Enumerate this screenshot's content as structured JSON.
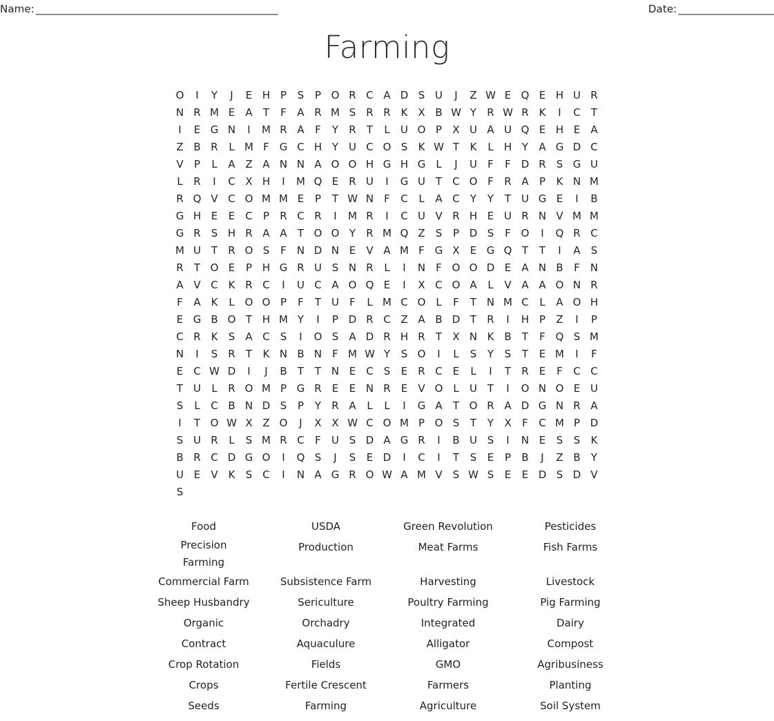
{
  "header": {
    "name_label": "Name:",
    "name_rule": "________________________________________________",
    "date_label": "Date:",
    "date_rule": "___________________"
  },
  "title": "Farming",
  "puzzle": {
    "columns": 25,
    "rows": 24,
    "grid": [
      "O I Y J E H P S P O R C A D S U J Z W E Q E H U",
      "R N R M E A T F A R M S R R K X B W Y R W R K I",
      "C T I E G N I M R A F Y R T L U O P X U A U Q E",
      "H E A Z B R L M F G C H Y U C O S K W T K L H Y",
      "A G D C V P L A Z A N N A O O H G H G L J U F F",
      "D R S G U L R I C X H I M Q E R U I G U T C O F",
      "R A P K N M R Q V C O M M E P T W N F C L A C Y",
      "Y T U G E I B G H E E C P R C R I M R I C U V R",
      "H E U R N V M M G R S H R A A T O O Y R M Q Z S",
      "P D S F O I Q R C M U T R O S F N D N E V A M F",
      "G X E G Q T T I A S R T O E P H G R U S N R L I",
      "N F O O D E A N B F N A V C K R C I U C A O Q E",
      "I X C O A L V A A O N R F A K L O O P F T U F L",
      "M C O L F T N M C L A O H E G B O T H M Y I P D",
      "R C Z A B D T R I H P Z I P C R K S A C S I O S",
      "A D R H R T X N K B T F Q S M N I S R T K N B N",
      "F M W Y S O I L S Y S T E M I F E C W D I J B T",
      "T N E C S E R C E L I T R E F C C T U L R O M P",
      "G R E E N R E V O L U T I O N O E U S L C B N D",
      "S P Y R A L L I G A T O R A D G N R A I T O W X",
      "Z O J X X W C O M P O S T Y X F C M P D S U R L",
      "S M R C F U S D A G R I B U S I N E S S K B R C",
      "D G O I Q S J S E D I C I T S E P B J Z B Y U E",
      "V K S C I N A G R O W A M V S W S E E D S D V S"
    ]
  },
  "wordlist": {
    "words": [
      "Food",
      "USDA",
      "Green Revolution",
      "Pesticides",
      "Precision Farming",
      "Production",
      "Meat Farms",
      "Fish Farms",
      "Commercial Farm",
      "Subsistence Farm",
      "Harvesting",
      "Livestock",
      "Sheep Husbandry",
      "Sericulture",
      "Poultry Farming",
      "Pig Farming",
      "Organic",
      "Orchadry",
      "Integrated",
      "Dairy",
      "Contract",
      "Aquaculure",
      "Alligator",
      "Compost",
      "Crop Rotation",
      "Fields",
      "GMO",
      "Agribusiness",
      "Crops",
      "Fertile Crescent",
      "Farmers",
      "Planting",
      "Seeds",
      "Farming",
      "Agriculture",
      "Soil System"
    ]
  },
  "colors": {
    "text": "#231f20",
    "title": "#2c2c2c",
    "background": "#ffffff"
  }
}
